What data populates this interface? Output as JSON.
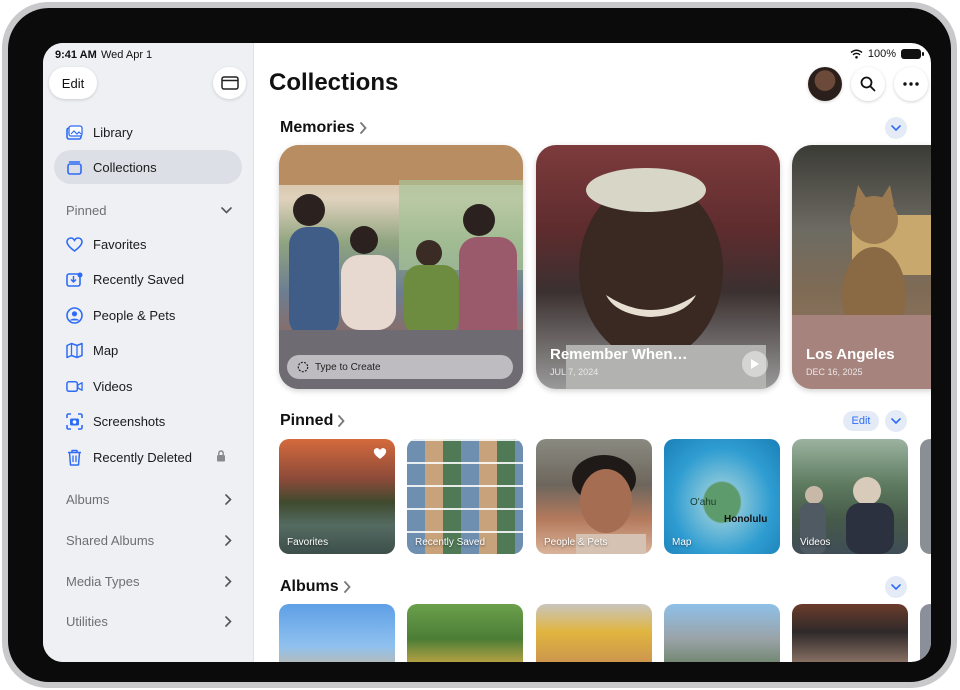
{
  "status": {
    "time": "9:41 AM",
    "date": "Wed Apr 1",
    "battery": "100%"
  },
  "sidebar": {
    "edit_label": "Edit",
    "items_top": [
      {
        "label": "Library",
        "icon": "photo-library-icon"
      },
      {
        "label": "Collections",
        "icon": "collections-icon",
        "selected": true
      }
    ],
    "pinned_header": "Pinned",
    "pinned_items": [
      {
        "label": "Favorites",
        "icon": "heart-icon"
      },
      {
        "label": "Recently Saved",
        "icon": "recently-saved-icon"
      },
      {
        "label": "People & Pets",
        "icon": "person-circle-icon"
      },
      {
        "label": "Map",
        "icon": "map-icon"
      },
      {
        "label": "Videos",
        "icon": "video-icon"
      },
      {
        "label": "Screenshots",
        "icon": "screenshot-icon"
      },
      {
        "label": "Recently Deleted",
        "icon": "trash-icon",
        "locked": true
      }
    ],
    "groups": [
      {
        "label": "Albums"
      },
      {
        "label": "Shared Albums"
      },
      {
        "label": "Media Types"
      },
      {
        "label": "Utilities"
      }
    ]
  },
  "main": {
    "title": "Collections",
    "memories": {
      "title": "Memories",
      "cards": [
        {
          "type_to_create": "Type to Create"
        },
        {
          "title": "Remember When…",
          "date": "JUL 7, 2024"
        },
        {
          "title": "Los Angeles",
          "date": "DEC 16, 2025"
        }
      ]
    },
    "pinned": {
      "title": "Pinned",
      "edit_label": "Edit",
      "cards": [
        {
          "label": "Favorites"
        },
        {
          "label": "Recently Saved"
        },
        {
          "label": "People & Pets"
        },
        {
          "label": "Map",
          "map_labels": [
            "O'ahu",
            "Honolulu"
          ]
        },
        {
          "label": "Videos"
        }
      ]
    },
    "albums": {
      "title": "Albums"
    }
  },
  "colors": {
    "accent": "#2f6cf6",
    "sidebar_bg": "#eef0f4",
    "selected_bg": "#dcdfe6"
  }
}
